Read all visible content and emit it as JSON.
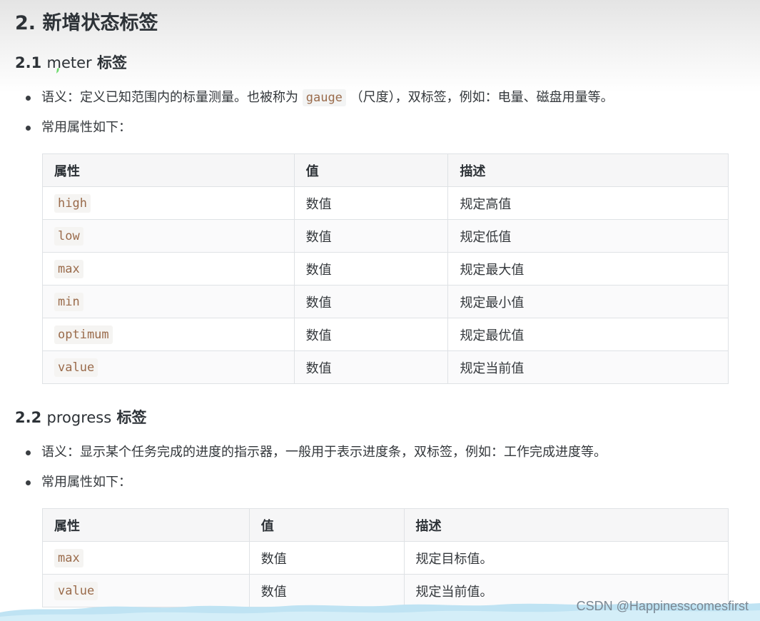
{
  "section_title": "2. 新增状态标签",
  "meter": {
    "heading_prefix": "2.1 ",
    "heading_code": "meter",
    "heading_suffix": " 标签",
    "semantics_before": "语义：定义已知范围内的标量测量。也被称为 ",
    "semantics_code": "gauge",
    "semantics_after": " （尺度），双标签，例如：电量、磁盘用量等。",
    "attrs_intro": "常用属性如下：",
    "table": {
      "headers": [
        "属性",
        "值",
        "描述"
      ],
      "rows": [
        {
          "attr": "high",
          "value": "数值",
          "desc": "规定高值"
        },
        {
          "attr": "low",
          "value": "数值",
          "desc": "规定低值"
        },
        {
          "attr": "max",
          "value": "数值",
          "desc": "规定最大值"
        },
        {
          "attr": "min",
          "value": "数值",
          "desc": "规定最小值"
        },
        {
          "attr": "optimum",
          "value": "数值",
          "desc": "规定最优值"
        },
        {
          "attr": "value",
          "value": "数值",
          "desc": "规定当前值"
        }
      ]
    }
  },
  "progress": {
    "heading_prefix": "2.2 ",
    "heading_code": "progress",
    "heading_suffix": " 标签",
    "semantics": "语义：显示某个任务完成的进度的指示器，一般用于表示进度条，双标签，例如：工作完成进度等。",
    "attrs_intro": "常用属性如下：",
    "table": {
      "headers": [
        "属性",
        "值",
        "描述"
      ],
      "rows": [
        {
          "attr": "max",
          "value": "数值",
          "desc": "规定目标值。"
        },
        {
          "attr": "value",
          "value": "数值",
          "desc": "规定当前值。"
        }
      ]
    }
  },
  "watermark": "CSDN @Happinesscomesfirst",
  "colors": {
    "code_text": "#9a6b4b",
    "code_bg": "#f3f4f4",
    "table_border": "#dfe2e5",
    "header_bg": "#f6f6f7",
    "wave": "#bfe3f3",
    "watermark": "#7b8792"
  }
}
